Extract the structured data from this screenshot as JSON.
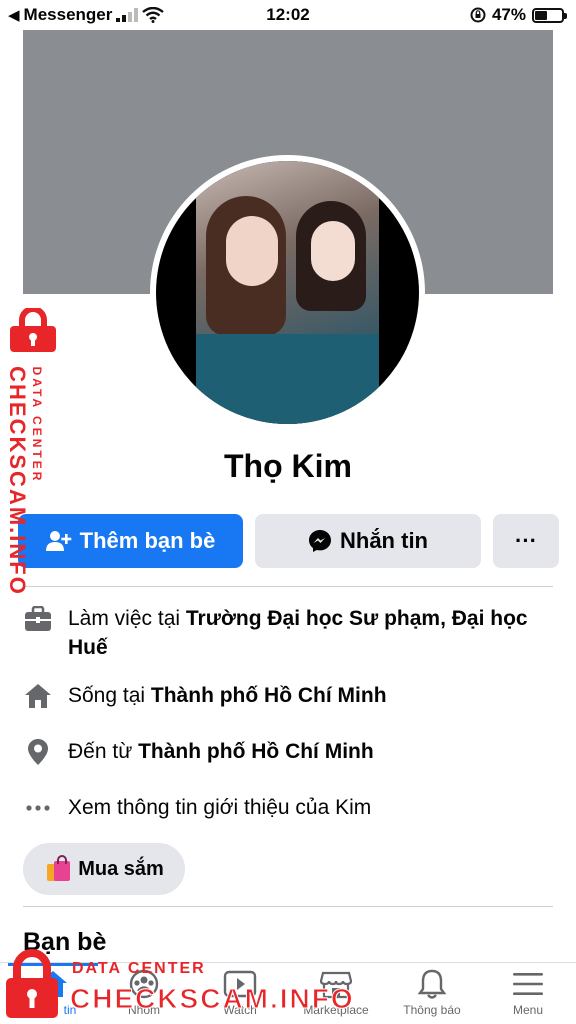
{
  "status_bar": {
    "back_app": "Messenger",
    "time": "12:02",
    "battery_percent": "47%",
    "battery_level": 0.47
  },
  "profile": {
    "name": "Thọ Kim"
  },
  "actions": {
    "add_friend_label": "Thêm bạn bè",
    "message_label": "Nhắn tin",
    "more_label": "···"
  },
  "intro": [
    {
      "icon": "briefcase-icon",
      "prefix": "Làm việc tại ",
      "bold": "Trường Đại học Sư phạm, Đại học Huế"
    },
    {
      "icon": "home-icon",
      "prefix": "Sống tại ",
      "bold": "Thành phố Hồ Chí Minh"
    },
    {
      "icon": "location-pin-icon",
      "prefix": "Đến từ ",
      "bold": "Thành phố Hồ Chí Minh"
    },
    {
      "icon": "ellipsis-icon",
      "prefix": "Xem thông tin giới thiệu của Kim",
      "bold": ""
    }
  ],
  "shop": {
    "label": "Mua sắm",
    "icon": "shopping-bag-icon"
  },
  "friends": {
    "title": "Bạn bè"
  },
  "tabbar": {
    "tabs": [
      {
        "label": "tin",
        "icon": "home-tab-icon",
        "active": true
      },
      {
        "label": "Nhóm",
        "icon": "groups-tab-icon",
        "active": false
      },
      {
        "label": "Watch",
        "icon": "watch-tab-icon",
        "active": false
      },
      {
        "label": "Marketplace",
        "icon": "marketplace-tab-icon",
        "active": false
      },
      {
        "label": "Thông báo",
        "icon": "bell-tab-icon",
        "active": false
      },
      {
        "label": "Menu",
        "icon": "menu-tab-icon",
        "active": false
      }
    ]
  },
  "watermark": {
    "side_main": "CHECKSCAM.INFO",
    "side_sub": "DATA CENTER",
    "bottom_main": "CHECKSCAM.INFO",
    "bottom_sub": "DATA CENTER"
  },
  "colors": {
    "brand_blue": "#1877f2",
    "button_gray": "#e4e6eb",
    "cover_gray": "#8a8d91",
    "watermark_red": "#e8262a"
  }
}
